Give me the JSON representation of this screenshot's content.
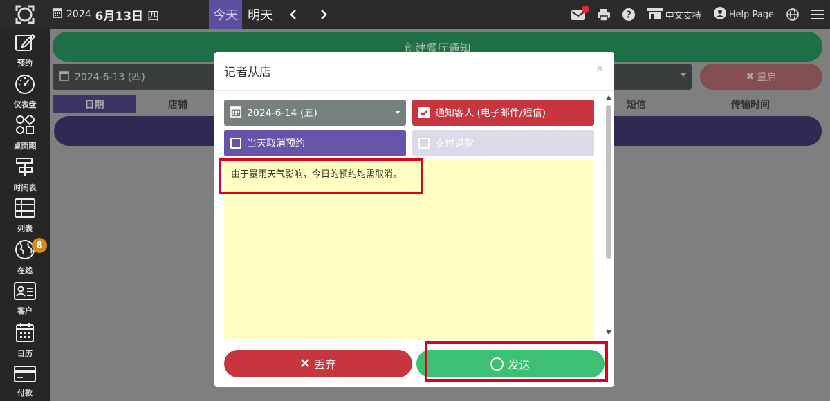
{
  "topbar": {
    "year": "2024",
    "month_day": "6月13日",
    "weekday": "四",
    "today_label": "今天",
    "tomorrow_label": "明天",
    "support_label": "中文支持",
    "help_label": "Help Page",
    "icons": [
      "logo-icon",
      "calendar-icon",
      "chevron-left-icon",
      "chevron-right-icon",
      "mail-icon",
      "print-icon",
      "help-circle-icon",
      "store-icon",
      "user-circle-icon",
      "globe-icon",
      "menu-icon"
    ]
  },
  "sidebar": {
    "items": [
      {
        "label": "预约",
        "icon": "edit-icon"
      },
      {
        "label": "仪表盘",
        "icon": "gauge-icon"
      },
      {
        "label": "桌面图",
        "icon": "table-layout-icon"
      },
      {
        "label": "时间表",
        "icon": "timeline-icon"
      },
      {
        "label": "列表",
        "icon": "list-icon"
      },
      {
        "label": "在线",
        "icon": "globe-icon",
        "badge": "8"
      },
      {
        "label": "客户",
        "icon": "contact-card-icon"
      },
      {
        "label": "日历",
        "icon": "calendar-icon"
      },
      {
        "label": "付款",
        "icon": "credit-card-icon"
      }
    ]
  },
  "background": {
    "create_label": "创建餐厅通知",
    "date_value": "2024-6-13 (四)",
    "restart_label": "重启",
    "columns": [
      "日期",
      "店铺",
      "短信",
      "传输时间"
    ]
  },
  "modal": {
    "title": "记者从店",
    "close": "×",
    "date_value": "2024-6-14 (五)",
    "notify_label": "通知客人 (电子邮件/短信)",
    "notify_checked": true,
    "cancel_label": "当天取消预约",
    "cancel_checked": false,
    "refund_label": "支付退款",
    "refund_checked": false,
    "message": "由于暴雨天气影响，今日的预约均需取消。",
    "discard_label": "丢弃",
    "send_label": "发送"
  },
  "colors": {
    "accent_purple": "#6654a9",
    "danger_red": "#c7363f",
    "success_green": "#3dbf74",
    "textarea_yellow": "#ffffc2",
    "highlight_red": "#e0001a"
  }
}
